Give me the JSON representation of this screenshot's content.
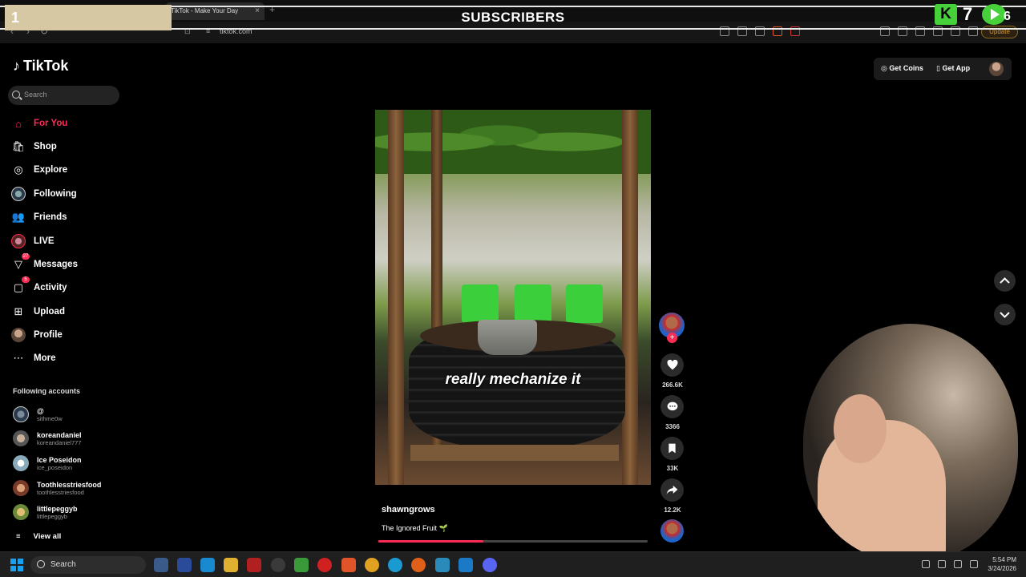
{
  "browser": {
    "tab_title": "TikTok - Make Your Day",
    "url": "tiktok.com",
    "update_label": "Update"
  },
  "overlay": {
    "box_number": "1",
    "title": "SUBSCRIBERS",
    "kick_count": "7",
    "play_count": "6",
    "accent_color": "#46d03a"
  },
  "tiktok": {
    "logo": "TikTok",
    "search_placeholder": "Search",
    "nav": [
      {
        "label": "For You",
        "icon": "home-icon"
      },
      {
        "label": "Shop",
        "icon": "shop-icon"
      },
      {
        "label": "Explore",
        "icon": "compass-icon"
      },
      {
        "label": "Following",
        "icon": "avatar"
      },
      {
        "label": "Friends",
        "icon": "friends-icon"
      },
      {
        "label": "LIVE",
        "icon": "avatar"
      },
      {
        "label": "Messages",
        "icon": "messages-icon",
        "badge": "27"
      },
      {
        "label": "Activity",
        "icon": "activity-icon",
        "badge": "5"
      },
      {
        "label": "Upload",
        "icon": "upload-icon"
      },
      {
        "label": "Profile",
        "icon": "avatar"
      },
      {
        "label": "More",
        "icon": "more-icon"
      }
    ],
    "following_title": "Following accounts",
    "accounts": [
      {
        "name": "@",
        "handle": "sithme0w"
      },
      {
        "name": "koreandaniel",
        "handle": "koreandaniel777"
      },
      {
        "name": "Ice Poseidon",
        "handle": "ice_poseidon"
      },
      {
        "name": "Toothlesstriesfood",
        "handle": "toothlesstriesfood"
      },
      {
        "name": "littlepeggyb",
        "handle": "littlepeggyb"
      }
    ],
    "view_all": "View all",
    "get_coins": "Get Coins",
    "get_app": "Get App",
    "video": {
      "caption": "really mechanize it",
      "author": "shawngrows",
      "description": "The Ignored Fruit 🌱",
      "progress": 0.39
    },
    "actions": {
      "likes": "266.6K",
      "comments": "3366",
      "saves": "33K",
      "shares": "12.2K"
    },
    "brand_color": "#fe2c55"
  },
  "taskbar": {
    "search_label": "Search",
    "time": "5:54 PM",
    "date": "3/24/2026"
  }
}
